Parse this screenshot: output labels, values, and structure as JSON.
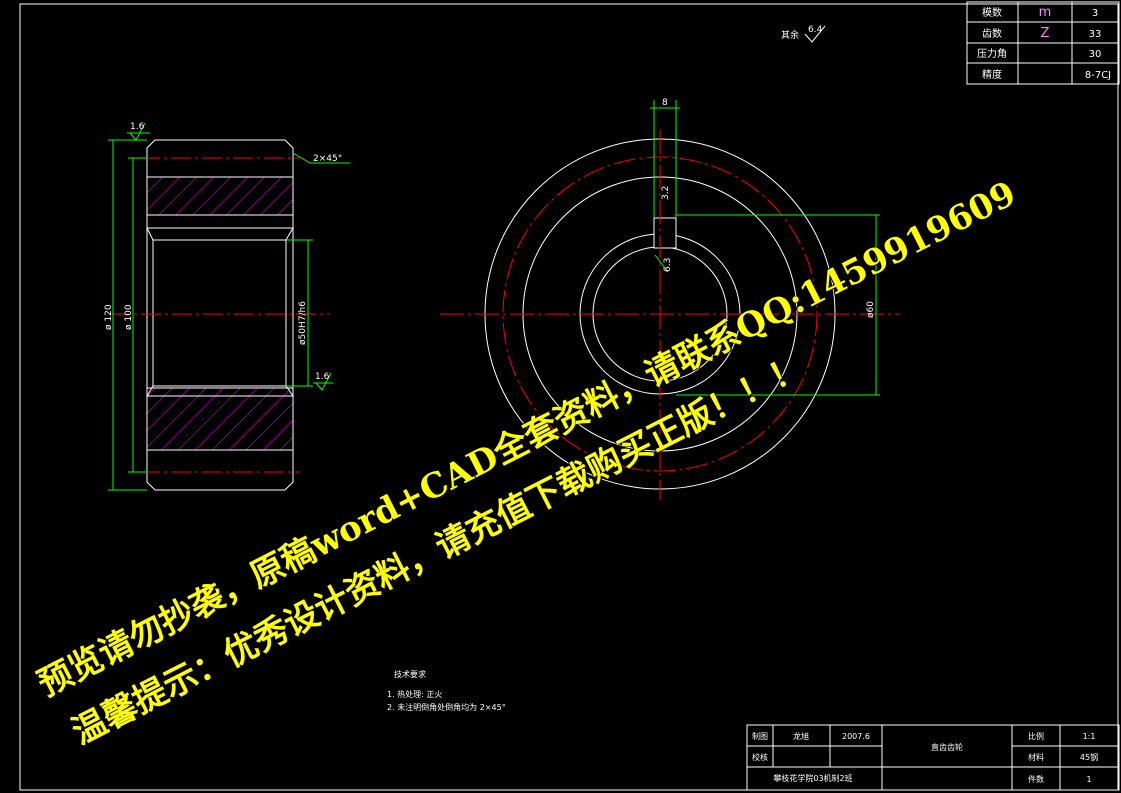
{
  "params_table": {
    "rows": [
      {
        "label": "模数",
        "symbol": "m",
        "value": "3"
      },
      {
        "label": "齿数",
        "symbol": "Z",
        "value": "33"
      },
      {
        "label": "压力角",
        "symbol": "",
        "value": "30"
      },
      {
        "label": "精度",
        "symbol": "",
        "value": "8-7CJ"
      }
    ]
  },
  "roughness_note": {
    "label": "其余",
    "value": "6.4"
  },
  "side_view": {
    "roughness_top": "1.6",
    "roughness_bore": "1.6",
    "chamfer": "2×45°",
    "dim_outer": "ø 120",
    "dim_root": "ø 100",
    "dim_bore": "ø50H7/h6"
  },
  "front_view": {
    "dim_keyway_width": "8",
    "dim_keyway_depth": "3.2",
    "dim_roughness": "6.3",
    "dim_hub": "ø60"
  },
  "tech_requirements": {
    "title": "技术要求",
    "items": [
      "1. 热处理: 正火",
      "2. 未注明倒角处倒角均为 2×45°"
    ]
  },
  "title_block": {
    "drawn_label": "制图",
    "drawn_name": "龙旭",
    "drawn_date": "2007.6",
    "check_label": "校核",
    "part_name": "直齿齿轮",
    "scale_label": "比例",
    "scale_value": "1:1",
    "material_label": "材料",
    "material_value": "45钢",
    "qty_label": "件数",
    "qty_value": "1",
    "school": "攀枝花学院03机制2班"
  },
  "watermark": {
    "line1": "预览请勿抄袭，原稿word+CAD全套资料，请联系QQ:1459919609",
    "line2": "温馨提示：优秀设计资料，请充值下载购买正版！！！"
  },
  "colors": {
    "outline": "#ffffff",
    "center_line": "#ff0000",
    "dimension": "#00ff00",
    "hatch": "#ff00ff",
    "watermark": "#ffff00",
    "background": "#000000"
  }
}
